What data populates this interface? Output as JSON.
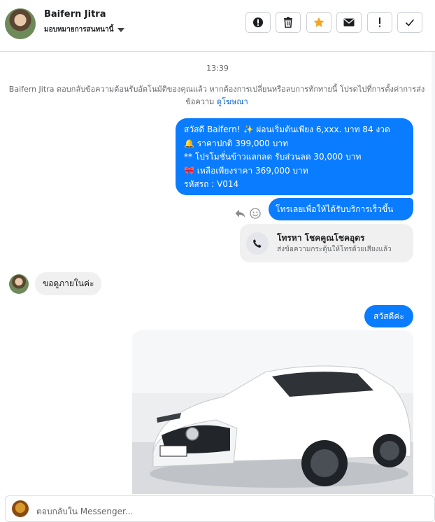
{
  "header": {
    "name": "Baifern Jitra",
    "assign_label": "มอบหมายการสนทนานี้",
    "toolbar": [
      "report-icon",
      "delete-icon",
      "star-icon",
      "mail-icon",
      "important-icon",
      "done-icon"
    ]
  },
  "chat": {
    "timestamp": "13:39",
    "system_note": "Baifern Jitra ตอบกลับข้อความต้อนรับอัตโนมัติของคุณแล้ว หากต้องการเปลี่ยนหรือลบการทักทายนี้ โปรดไปที่การตั้งค่าการส่งข้อความ",
    "system_link": "ดูโฆษณา",
    "outgoing_promo_lines": [
      "สวัสดี Baifern! ✨  ผ่อนเริ่มต้นเพียง 6,xxx. บาท 84 งวด",
      "🔔 ราคาปกติ 399,000 บาท",
      "** โปรโมชั่นข้าวแลกลด รับส่วนลด 30,000 บาท",
      "🎀  เหลือเพียงราคา 369,000 บาท",
      " รหัสรถ : V014"
    ],
    "outgoing_call_prompt": "โทรเลยเพื่อให้ได้รับบริการเร็วขึ้น",
    "call_card": {
      "title": "โทรหา โชคคูณโชคอุดร",
      "subtitle": "ส่งข้อความกระตุ้นให้โทรด้วยเสียงแล้ว"
    },
    "incoming_msg": "ขอดูภายในค่ะ",
    "outgoing_greeting": "สวัสดีค่ะ",
    "photo": {
      "plate_text": "3ขว 2969"
    }
  },
  "composer": {
    "placeholder": "ตอบกลับใน Messenger..."
  },
  "colors": {
    "bubble_out": "#0a7cff",
    "bubble_in": "#f0f0f0",
    "link": "#0866c6"
  }
}
